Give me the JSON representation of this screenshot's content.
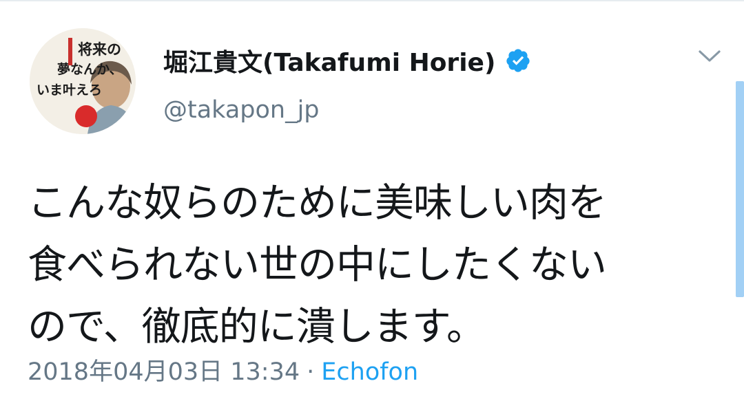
{
  "tweet": {
    "author": {
      "display_name": "堀江貴文(Takafumi Horie)",
      "handle": "@takapon_jp",
      "verified": true,
      "avatar_book_title": [
        "将来の",
        "夢なんか、",
        "いま叶えろ"
      ]
    },
    "text_lines": [
      "こんな奴らのために美味しい肉を",
      "食べられない世の中にしたくない",
      "ので、徹底的に潰します。"
    ],
    "timestamp": "2018年04月03日 13:34",
    "separator": "·",
    "source": "Echofon"
  },
  "icons": {
    "verified": "verified-badge-icon",
    "menu": "chevron-down-icon"
  },
  "colors": {
    "text_primary": "#14171a",
    "text_secondary": "#657786",
    "accent": "#1da1f2",
    "scroll": "#a2d0f5"
  }
}
